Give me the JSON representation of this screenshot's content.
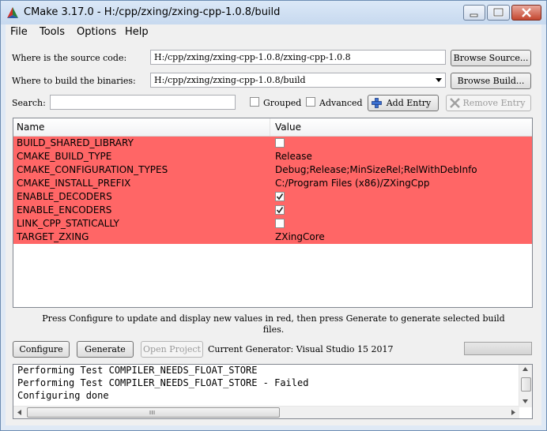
{
  "window": {
    "title": "CMake 3.17.0 - H:/cpp/zxing/zxing-cpp-1.0.8/build"
  },
  "menu": [
    "File",
    "Tools",
    "Options",
    "Help"
  ],
  "source": {
    "label": "Where is the source code:",
    "value": "H:/cpp/zxing/zxing-cpp-1.0.8/zxing-cpp-1.0.8",
    "browse_label": "Browse Source..."
  },
  "build": {
    "label": "Where to build the binaries:",
    "value": "H:/cpp/zxing/zxing-cpp-1.0.8/build",
    "browse_label": "Browse Build..."
  },
  "search": {
    "label": "Search:",
    "value": "",
    "grouped_label": "Grouped",
    "grouped_checked": false,
    "advanced_label": "Advanced",
    "advanced_checked": false,
    "add_entry_label": "Add Entry",
    "remove_entry_label": "Remove Entry"
  },
  "table": {
    "columns": [
      "Name",
      "Value"
    ],
    "row_color": "#ff6666",
    "rows": [
      {
        "name": "BUILD_SHARED_LIBRARY",
        "type": "bool",
        "checked": false,
        "value": ""
      },
      {
        "name": "CMAKE_BUILD_TYPE",
        "type": "text",
        "value": "Release"
      },
      {
        "name": "CMAKE_CONFIGURATION_TYPES",
        "type": "text",
        "value": "Debug;Release;MinSizeRel;RelWithDebInfo"
      },
      {
        "name": "CMAKE_INSTALL_PREFIX",
        "type": "text",
        "value": "C:/Program Files (x86)/ZXingCpp"
      },
      {
        "name": "ENABLE_DECODERS",
        "type": "bool",
        "checked": true,
        "value": ""
      },
      {
        "name": "ENABLE_ENCODERS",
        "type": "bool",
        "checked": true,
        "value": ""
      },
      {
        "name": "LINK_CPP_STATICALLY",
        "type": "bool",
        "checked": false,
        "value": ""
      },
      {
        "name": "TARGET_ZXING",
        "type": "text",
        "value": "ZXingCore"
      }
    ]
  },
  "status": {
    "line1": "Press Configure to update and display new values in red, then press Generate to generate selected build",
    "line2": "files."
  },
  "actions": {
    "configure_label": "Configure",
    "generate_label": "Generate",
    "open_project_label": "Open Project",
    "generator_text": "Current Generator: Visual Studio 15 2017"
  },
  "output": {
    "lines": [
      "Performing Test COMPILER_NEEDS_FLOAT_STORE",
      "Performing Test COMPILER_NEEDS_FLOAT_STORE - Failed",
      "Configuring done"
    ]
  }
}
